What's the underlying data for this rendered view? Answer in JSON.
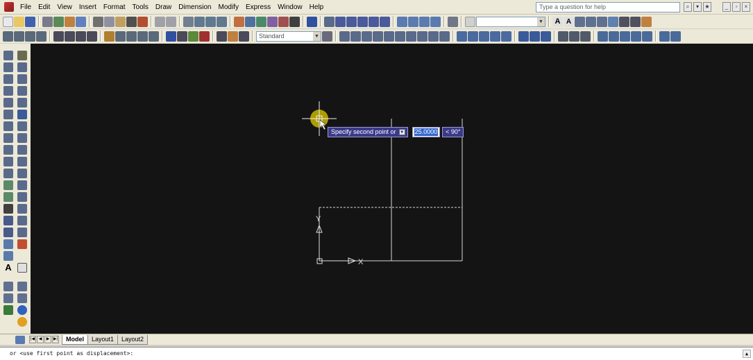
{
  "menu": {
    "items": [
      "File",
      "Edit",
      "View",
      "Insert",
      "Format",
      "Tools",
      "Draw",
      "Dimension",
      "Modify",
      "Express",
      "Window",
      "Help"
    ],
    "help_placeholder": "Type a question for help"
  },
  "toolbar": {
    "text_style": "Standard"
  },
  "dynamic_input": {
    "prompt": "Specify second point or",
    "value": "25.0000",
    "angle": "< 90°"
  },
  "ucs": {
    "y_label": "Y",
    "x_label": "X"
  },
  "layout_tabs": [
    "Model",
    "Layout1",
    "Layout2"
  ],
  "command_line": {
    "text": "or <use first point as displacement>:"
  },
  "colors": {
    "canvas_bg": "#141414",
    "cursor_highlight": "#c8b400",
    "prompt_bg": "#3a3a8a",
    "selection": "#3366cc"
  }
}
